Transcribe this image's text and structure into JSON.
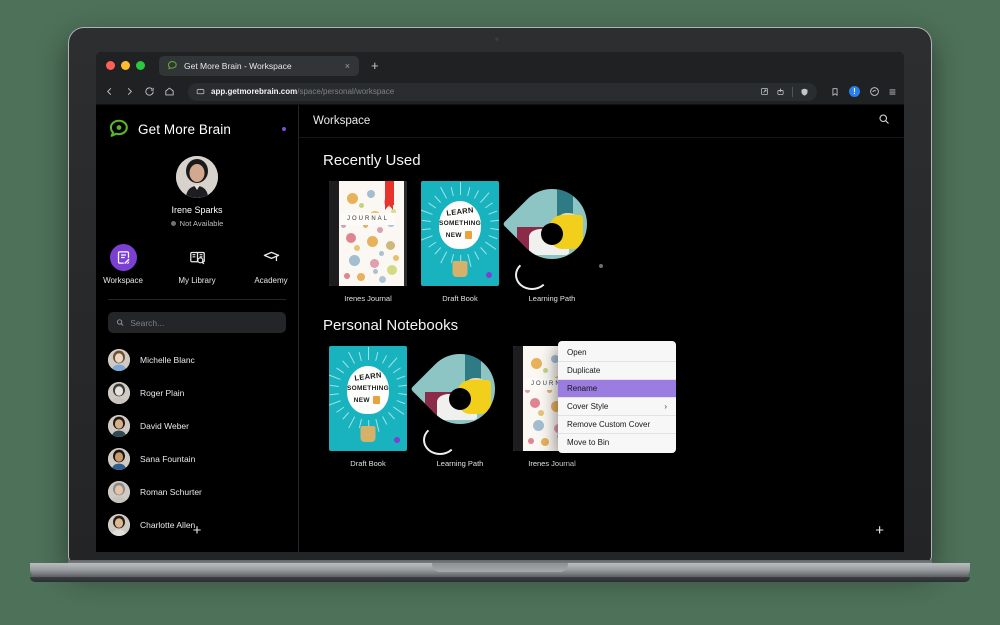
{
  "browser": {
    "tab": {
      "title": "Get More Brain - Workspace",
      "favicon": "getmorebrain-logo-icon",
      "close_label": "×"
    },
    "new_tab_label": "+",
    "url_host": "app.getmorebrain.com",
    "url_path": "/space/personal/workspace",
    "nav": {
      "back": "‹",
      "forward": "›",
      "reload": "↻",
      "home": "⌂",
      "bookmark": "bookmark-icon"
    },
    "omnibox_icons": [
      "share-icon",
      "download-icon",
      "shield-icon"
    ],
    "toolbar_right": {
      "profile_initial": "!",
      "extensions": "extension-icon",
      "menu": "≡"
    }
  },
  "sidebar": {
    "brand": "Get More Brain",
    "profile": {
      "name": "Irene Sparks",
      "status": "Not Available"
    },
    "nav_items": [
      {
        "label": "Workspace",
        "icon": "workspace-icon",
        "active": true
      },
      {
        "label": "My Library",
        "icon": "library-icon",
        "active": false
      },
      {
        "label": "Academy",
        "icon": "academy-cap-icon",
        "active": false
      }
    ],
    "search": {
      "placeholder": "Search...",
      "value": "",
      "icon": "search-icon"
    },
    "contacts": [
      {
        "name": "Michelle Blanc"
      },
      {
        "name": "Roger Plain"
      },
      {
        "name": "David Weber"
      },
      {
        "name": "Sana Fountain"
      },
      {
        "name": "Roman Schurter"
      },
      {
        "name": "Charlotte Allen"
      }
    ],
    "add_label": "+"
  },
  "main": {
    "title": "Workspace",
    "search_icon": "search-icon",
    "add_label": "+",
    "sections": [
      {
        "title": "Recently Used",
        "cards": [
          {
            "label": "Irenes Journal",
            "cover": "journal"
          },
          {
            "label": "Draft Book",
            "cover": "draft"
          },
          {
            "label": "Learning Path",
            "cover": "pin"
          }
        ]
      },
      {
        "title": "Personal Notebooks",
        "cards": [
          {
            "label": "Draft Book",
            "cover": "draft"
          },
          {
            "label": "Learning Path",
            "cover": "pin"
          },
          {
            "label": "Irenes Journal",
            "cover": "journal"
          }
        ]
      }
    ]
  },
  "context_menu": {
    "items": [
      {
        "label": "Open",
        "highlighted": false,
        "submenu": false
      },
      {
        "label": "Duplicate",
        "highlighted": false,
        "submenu": false
      },
      {
        "label": "Rename",
        "highlighted": true,
        "submenu": false
      },
      {
        "label": "Cover Style",
        "highlighted": false,
        "submenu": true,
        "chevron": "›"
      },
      {
        "label": "Remove Custom Cover",
        "highlighted": false,
        "submenu": false
      },
      {
        "label": "Move to Bin",
        "highlighted": false,
        "submenu": false
      }
    ]
  },
  "covers": {
    "journal_title": "JOURNAL",
    "draft_lines": [
      "LEARN",
      "SOMETHING",
      "NEW"
    ]
  },
  "colors": {
    "accent_purple": "#7b3fd4",
    "menu_highlight": "#9b7ce0",
    "brand_green": "#5ab42c",
    "draft_teal": "#18b3bf",
    "ribbon_red": "#e8322a",
    "background": "#000000"
  }
}
